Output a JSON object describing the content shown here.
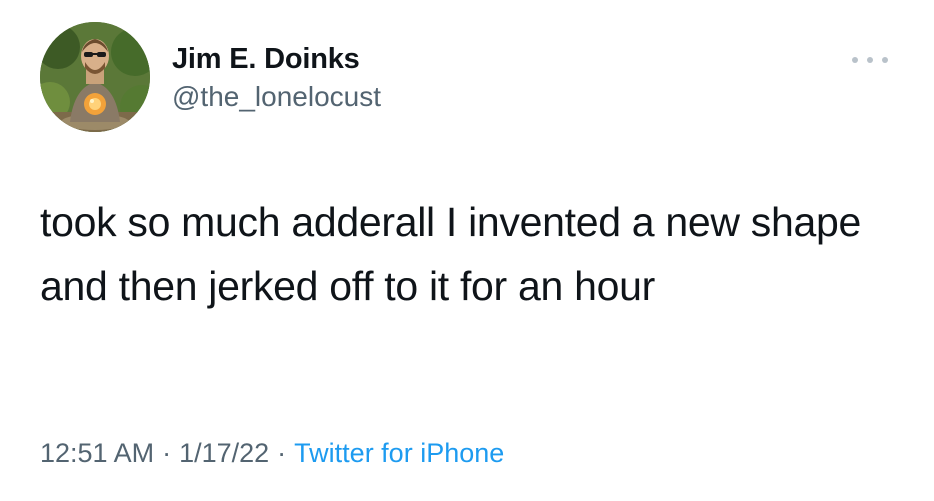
{
  "tweet": {
    "author": {
      "display_name": "Jim E. Doinks",
      "handle": "@the_lonelocust"
    },
    "more_icon": "more-horizontal-icon",
    "text": "took so much adderall I invented a new shape and then jerked off to it for an hour",
    "meta": {
      "time": "12:51 AM",
      "separator": "·",
      "date": "1/17/22",
      "source": "Twitter for iPhone"
    }
  },
  "colors": {
    "text": "#0f1419",
    "secondary": "#536471",
    "link": "#1d9bf0",
    "background": "#ffffff"
  }
}
